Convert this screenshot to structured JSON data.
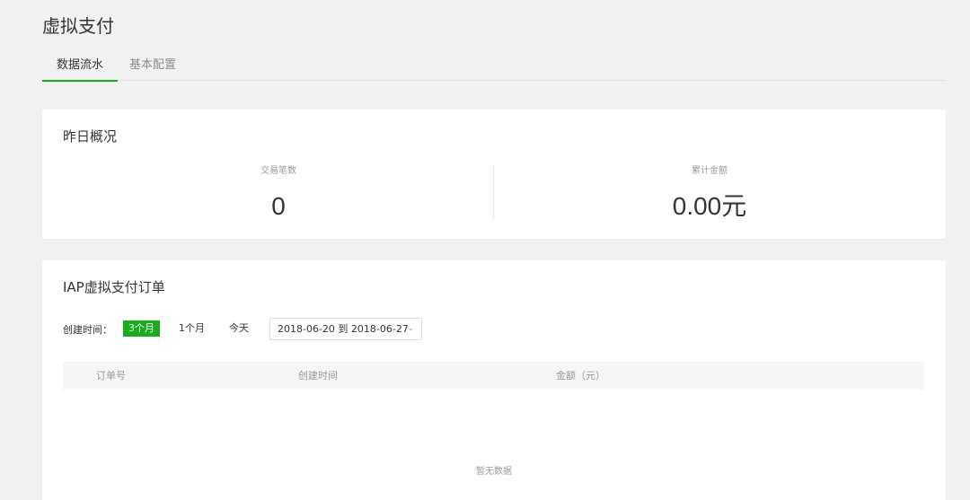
{
  "page": {
    "title": "虚拟支付",
    "tabs": [
      {
        "label": "数据流水",
        "active": true
      },
      {
        "label": "基本配置",
        "active": false
      }
    ]
  },
  "overview": {
    "title": "昨日概况",
    "stats": [
      {
        "label": "交易笔数",
        "value": "0"
      },
      {
        "label": "累计金额",
        "value": "0.00元"
      }
    ]
  },
  "orders": {
    "title": "IAP虚拟支付订单",
    "filter": {
      "label": "创建时间：",
      "ranges": [
        "3个月",
        "1个月",
        "今天"
      ],
      "active_range": "3个月",
      "date_range": "2018-06-20 到 2018-06-27"
    },
    "columns": [
      "订单号",
      "创建时间",
      "金额（元）"
    ],
    "empty_text": "暂无数据"
  },
  "colors": {
    "accent": "#1aad19",
    "background": "#f2f2f2"
  }
}
